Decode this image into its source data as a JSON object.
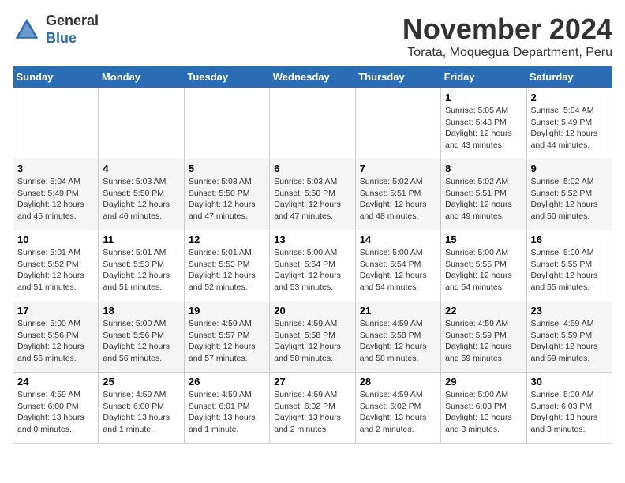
{
  "logo": {
    "general": "General",
    "blue": "Blue"
  },
  "title": "November 2024",
  "subtitle": "Torata, Moquegua Department, Peru",
  "days_of_week": [
    "Sunday",
    "Monday",
    "Tuesday",
    "Wednesday",
    "Thursday",
    "Friday",
    "Saturday"
  ],
  "weeks": [
    [
      {
        "day": "",
        "info": ""
      },
      {
        "day": "",
        "info": ""
      },
      {
        "day": "",
        "info": ""
      },
      {
        "day": "",
        "info": ""
      },
      {
        "day": "",
        "info": ""
      },
      {
        "day": "1",
        "info": "Sunrise: 5:05 AM\nSunset: 5:48 PM\nDaylight: 12 hours\nand 43 minutes."
      },
      {
        "day": "2",
        "info": "Sunrise: 5:04 AM\nSunset: 5:49 PM\nDaylight: 12 hours\nand 44 minutes."
      }
    ],
    [
      {
        "day": "3",
        "info": "Sunrise: 5:04 AM\nSunset: 5:49 PM\nDaylight: 12 hours\nand 45 minutes."
      },
      {
        "day": "4",
        "info": "Sunrise: 5:03 AM\nSunset: 5:50 PM\nDaylight: 12 hours\nand 46 minutes."
      },
      {
        "day": "5",
        "info": "Sunrise: 5:03 AM\nSunset: 5:50 PM\nDaylight: 12 hours\nand 47 minutes."
      },
      {
        "day": "6",
        "info": "Sunrise: 5:03 AM\nSunset: 5:50 PM\nDaylight: 12 hours\nand 47 minutes."
      },
      {
        "day": "7",
        "info": "Sunrise: 5:02 AM\nSunset: 5:51 PM\nDaylight: 12 hours\nand 48 minutes."
      },
      {
        "day": "8",
        "info": "Sunrise: 5:02 AM\nSunset: 5:51 PM\nDaylight: 12 hours\nand 49 minutes."
      },
      {
        "day": "9",
        "info": "Sunrise: 5:02 AM\nSunset: 5:52 PM\nDaylight: 12 hours\nand 50 minutes."
      }
    ],
    [
      {
        "day": "10",
        "info": "Sunrise: 5:01 AM\nSunset: 5:52 PM\nDaylight: 12 hours\nand 51 minutes."
      },
      {
        "day": "11",
        "info": "Sunrise: 5:01 AM\nSunset: 5:53 PM\nDaylight: 12 hours\nand 51 minutes."
      },
      {
        "day": "12",
        "info": "Sunrise: 5:01 AM\nSunset: 5:53 PM\nDaylight: 12 hours\nand 52 minutes."
      },
      {
        "day": "13",
        "info": "Sunrise: 5:00 AM\nSunset: 5:54 PM\nDaylight: 12 hours\nand 53 minutes."
      },
      {
        "day": "14",
        "info": "Sunrise: 5:00 AM\nSunset: 5:54 PM\nDaylight: 12 hours\nand 54 minutes."
      },
      {
        "day": "15",
        "info": "Sunrise: 5:00 AM\nSunset: 5:55 PM\nDaylight: 12 hours\nand 54 minutes."
      },
      {
        "day": "16",
        "info": "Sunrise: 5:00 AM\nSunset: 5:55 PM\nDaylight: 12 hours\nand 55 minutes."
      }
    ],
    [
      {
        "day": "17",
        "info": "Sunrise: 5:00 AM\nSunset: 5:56 PM\nDaylight: 12 hours\nand 56 minutes."
      },
      {
        "day": "18",
        "info": "Sunrise: 5:00 AM\nSunset: 5:56 PM\nDaylight: 12 hours\nand 56 minutes."
      },
      {
        "day": "19",
        "info": "Sunrise: 4:59 AM\nSunset: 5:57 PM\nDaylight: 12 hours\nand 57 minutes."
      },
      {
        "day": "20",
        "info": "Sunrise: 4:59 AM\nSunset: 5:58 PM\nDaylight: 12 hours\nand 58 minutes."
      },
      {
        "day": "21",
        "info": "Sunrise: 4:59 AM\nSunset: 5:58 PM\nDaylight: 12 hours\nand 58 minutes."
      },
      {
        "day": "22",
        "info": "Sunrise: 4:59 AM\nSunset: 5:59 PM\nDaylight: 12 hours\nand 59 minutes."
      },
      {
        "day": "23",
        "info": "Sunrise: 4:59 AM\nSunset: 5:59 PM\nDaylight: 12 hours\nand 59 minutes."
      }
    ],
    [
      {
        "day": "24",
        "info": "Sunrise: 4:59 AM\nSunset: 6:00 PM\nDaylight: 13 hours\nand 0 minutes."
      },
      {
        "day": "25",
        "info": "Sunrise: 4:59 AM\nSunset: 6:00 PM\nDaylight: 13 hours\nand 1 minute."
      },
      {
        "day": "26",
        "info": "Sunrise: 4:59 AM\nSunset: 6:01 PM\nDaylight: 13 hours\nand 1 minute."
      },
      {
        "day": "27",
        "info": "Sunrise: 4:59 AM\nSunset: 6:02 PM\nDaylight: 13 hours\nand 2 minutes."
      },
      {
        "day": "28",
        "info": "Sunrise: 4:59 AM\nSunset: 6:02 PM\nDaylight: 13 hours\nand 2 minutes."
      },
      {
        "day": "29",
        "info": "Sunrise: 5:00 AM\nSunset: 6:03 PM\nDaylight: 13 hours\nand 3 minutes."
      },
      {
        "day": "30",
        "info": "Sunrise: 5:00 AM\nSunset: 6:03 PM\nDaylight: 13 hours\nand 3 minutes."
      }
    ]
  ]
}
